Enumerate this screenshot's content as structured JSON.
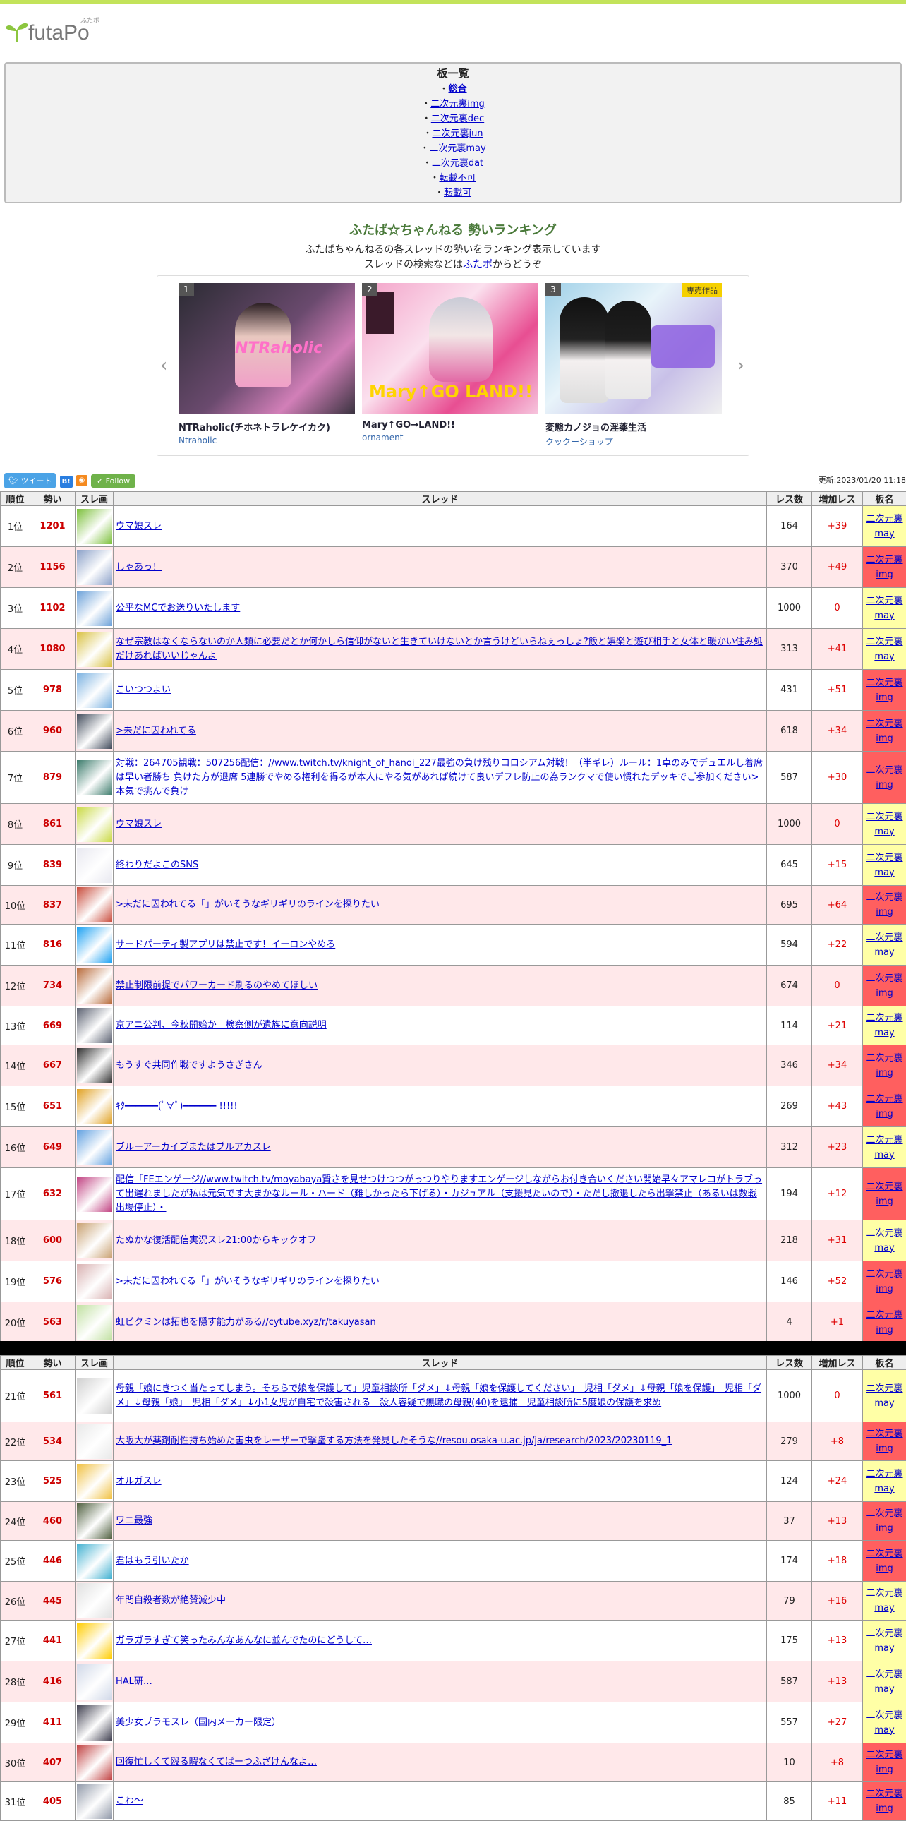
{
  "logo": {
    "text": "futaPo",
    "sub": "ふたポ"
  },
  "boards": {
    "title": "板一覧",
    "items": [
      "総合",
      "二次元裏img",
      "二次元裏dec",
      "二次元裏jun",
      "二次元裏may",
      "二次元裏dat",
      "転載不可",
      "転載可"
    ]
  },
  "ranking": {
    "title": "ふたば☆ちゃんねる 勢いランキング",
    "desc1": "ふたばちゃんねるの各スレッドの勢いをランキング表示しています",
    "desc2_pre": "スレッドの検索などは",
    "desc2_link": "ふたポ",
    "desc2_post": "からどうぞ"
  },
  "carousel": {
    "prev": "‹",
    "next": "›",
    "cards": [
      {
        "num": "1",
        "name": "NTRaholic(チホネトラレケイカク)",
        "maker": "Ntraholic",
        "badge": ""
      },
      {
        "num": "2",
        "name": "Mary↑GO→LAND!!",
        "maker": "ornament",
        "badge": ""
      },
      {
        "num": "3",
        "name": "変態カノジョの淫薬生活",
        "maker": "クックーショップ",
        "badge": "専売作品"
      }
    ]
  },
  "social": {
    "tweet": "ツイート",
    "hatena": "B!",
    "rss": "◉",
    "follow": "Follow"
  },
  "updated": "更新:2023/01/20 11:18",
  "headers": {
    "pos": "順位",
    "ikioi": "勢い",
    "thumb": "スレ画",
    "thread": "スレッド",
    "res": "レス数",
    "inc": "増加レス",
    "board": "板名"
  },
  "colors": {
    "may": "#ffffa6",
    "img": "#ff5f5f",
    "odd": "#ffffff",
    "even": "#ffe8ea",
    "accent": "#c3e35a"
  },
  "rows1": [
    {
      "pos": "1位",
      "ikioi": "1201",
      "title": "ウマ娘スレ",
      "res": "164",
      "inc": "+39",
      "board": "二次元裏may",
      "b": "may"
    },
    {
      "pos": "2位",
      "ikioi": "1156",
      "title": "しゃあっ！",
      "res": "370",
      "inc": "+49",
      "board": "二次元裏img",
      "b": "img"
    },
    {
      "pos": "3位",
      "ikioi": "1102",
      "title": "公平なMCでお送りいたします",
      "res": "1000",
      "inc": "0",
      "board": "二次元裏may",
      "b": "may"
    },
    {
      "pos": "4位",
      "ikioi": "1080",
      "title": "なぜ宗教はなくならないのか人類に必要だとか何かしら信仰がないと生きていけないとか言うけどいらねぇっしょ?飯と娯楽と遊び相手と女体と暖かい住み処だけあればいいじゃんよ",
      "res": "313",
      "inc": "+41",
      "board": "二次元裏may",
      "b": "may"
    },
    {
      "pos": "5位",
      "ikioi": "978",
      "title": "こいつつよい",
      "res": "431",
      "inc": "+51",
      "board": "二次元裏img",
      "b": "img"
    },
    {
      "pos": "6位",
      "ikioi": "960",
      "title": ">未だに囚われてる",
      "res": "618",
      "inc": "+34",
      "board": "二次元裏img",
      "b": "img"
    },
    {
      "pos": "7位",
      "ikioi": "879",
      "title": "対戦：264705観戦：507256配信：//www.twitch.tv/knight_of_hanoi_227最強の負け残りコロシアム対戦！（半ギレ）ルール：1卓のみでデュエルし着席は早い者勝ち 負けた方が退席 5連勝でやめる権利を得るが本人にやる気があれば続けて良いデフレ防止の為ランクマで使い慣れたデッキでご参加ください>本気で挑んで負け",
      "res": "587",
      "inc": "+30",
      "board": "二次元裏img",
      "b": "img"
    },
    {
      "pos": "8位",
      "ikioi": "861",
      "title": "ウマ娘スレ",
      "res": "1000",
      "inc": "0",
      "board": "二次元裏may",
      "b": "may"
    },
    {
      "pos": "9位",
      "ikioi": "839",
      "title": "終わりだよこのSNS",
      "res": "645",
      "inc": "+15",
      "board": "二次元裏may",
      "b": "may"
    },
    {
      "pos": "10位",
      "ikioi": "837",
      "title": ">未だに囚われてる「」がいそうなギリギリのラインを探りたい",
      "res": "695",
      "inc": "+64",
      "board": "二次元裏img",
      "b": "img"
    },
    {
      "pos": "11位",
      "ikioi": "816",
      "title": "サードパーティ製アプリは禁止です！イーロンやめろ",
      "res": "594",
      "inc": "+22",
      "board": "二次元裏may",
      "b": "may"
    },
    {
      "pos": "12位",
      "ikioi": "734",
      "title": "禁止制限前提でパワーカード刷るのやめてほしい",
      "res": "674",
      "inc": "0",
      "board": "二次元裏img",
      "b": "img"
    },
    {
      "pos": "13位",
      "ikioi": "669",
      "title": "京アニ公判、今秋開始か　検察側が遺族に意向説明",
      "res": "114",
      "inc": "+21",
      "board": "二次元裏may",
      "b": "may"
    },
    {
      "pos": "14位",
      "ikioi": "667",
      "title": "もうすぐ共同作戦ですようさぎさん",
      "res": "346",
      "inc": "+34",
      "board": "二次元裏img",
      "b": "img"
    },
    {
      "pos": "15位",
      "ikioi": "651",
      "title": "ｷﾀ━━━━━━(ﾟ∀ﾟ)━━━━━━ !!!!!",
      "res": "269",
      "inc": "+43",
      "board": "二次元裏img",
      "b": "img"
    },
    {
      "pos": "16位",
      "ikioi": "649",
      "title": "ブルーアーカイブまたはブルアカスレ",
      "res": "312",
      "inc": "+23",
      "board": "二次元裏may",
      "b": "may"
    },
    {
      "pos": "17位",
      "ikioi": "632",
      "title": "配信「FEエンゲージ//www.twitch.tv/moyabaya賢さを見せつけつつがっつりやりますエンゲージしながらお付き合いください開始早々アマレコがトラブって出遅れましたが私は元気です大まかなルール・ハード（難しかったら下げる）・カジュアル（支援見たいので）・ただし撤退したら出撃禁止（あるいは数戦出場停止）・",
      "res": "194",
      "inc": "+12",
      "board": "二次元裏img",
      "b": "img"
    },
    {
      "pos": "18位",
      "ikioi": "600",
      "title": "たぬかな復活配信実況スレ21:00からキックオフ",
      "res": "218",
      "inc": "+31",
      "board": "二次元裏may",
      "b": "may"
    },
    {
      "pos": "19位",
      "ikioi": "576",
      "title": ">未だに囚われてる「」がいそうなギリギリのラインを探りたい",
      "res": "146",
      "inc": "+52",
      "board": "二次元裏img",
      "b": "img"
    },
    {
      "pos": "20位",
      "ikioi": "563",
      "title": "虹ピクミンは拓也を隠す能力がある//cytube.xyz/r/takuyasan",
      "res": "4",
      "inc": "+1",
      "board": "二次元裏img",
      "b": "img"
    }
  ],
  "rows2": [
    {
      "pos": "21位",
      "ikioi": "561",
      "title": "母親「娘にきつく当たってしまう。そちらで娘を保護して」児童相談所「ダメ」↓母親「娘を保護してください」　児相「ダメ」↓母親「娘を保護」　児相「ダメ」↓母親「娘」　児相「ダメ」↓小1女児が自宅で殺害される　殺人容疑で無職の母親(40)を逮捕　児童相談所に5度娘の保護を求め",
      "res": "1000",
      "inc": "0",
      "board": "二次元裏may",
      "b": "may"
    },
    {
      "pos": "22位",
      "ikioi": "534",
      "title": "大阪大が薬剤耐性持ち始めた害虫をレーザーで撃墜する方法を発見したそうな//resou.osaka-u.ac.jp/ja/research/2023/20230119_1",
      "res": "279",
      "inc": "+8",
      "board": "二次元裏img",
      "b": "img"
    },
    {
      "pos": "23位",
      "ikioi": "525",
      "title": "オルガスレ",
      "res": "124",
      "inc": "+24",
      "board": "二次元裏may",
      "b": "may"
    },
    {
      "pos": "24位",
      "ikioi": "460",
      "title": "ワニ最強",
      "res": "37",
      "inc": "+13",
      "board": "二次元裏img",
      "b": "img"
    },
    {
      "pos": "25位",
      "ikioi": "446",
      "title": "君はもう引いたか",
      "res": "174",
      "inc": "+18",
      "board": "二次元裏img",
      "b": "img"
    },
    {
      "pos": "26位",
      "ikioi": "445",
      "title": "年間自殺者数が絶賛減少中",
      "res": "79",
      "inc": "+16",
      "board": "二次元裏may",
      "b": "may"
    },
    {
      "pos": "27位",
      "ikioi": "441",
      "title": "ガラガラすぎて笑ったみんなあんなに並んでたのにどうして…",
      "res": "175",
      "inc": "+13",
      "board": "二次元裏may",
      "b": "may"
    },
    {
      "pos": "28位",
      "ikioi": "416",
      "title": "HAL研…",
      "res": "587",
      "inc": "+13",
      "board": "二次元裏may",
      "b": "may"
    },
    {
      "pos": "29位",
      "ikioi": "411",
      "title": "美少女プラモスレ（国内メーカー限定）",
      "res": "557",
      "inc": "+27",
      "board": "二次元裏may",
      "b": "may"
    },
    {
      "pos": "30位",
      "ikioi": "407",
      "title": "回復忙しくて殴る暇なくてぱーつふざけんなよ…",
      "res": "10",
      "inc": "+8",
      "board": "二次元裏img",
      "b": "img"
    },
    {
      "pos": "31位",
      "ikioi": "405",
      "title": "こわ〜",
      "res": "85",
      "inc": "+11",
      "board": "二次元裏img",
      "b": "img"
    }
  ]
}
